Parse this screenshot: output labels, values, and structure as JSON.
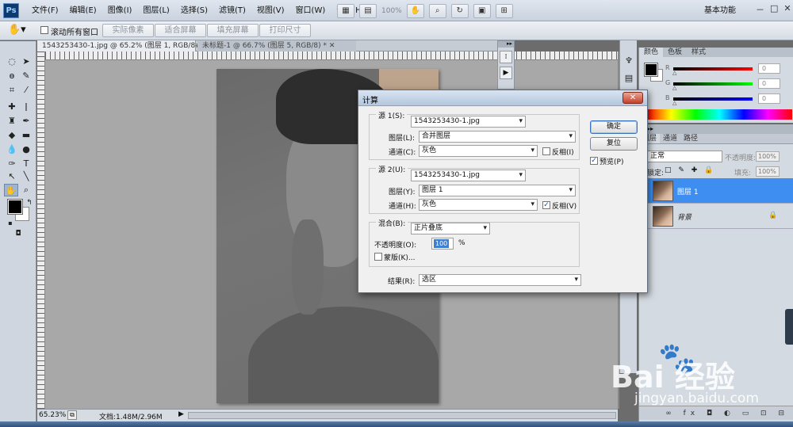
{
  "app": {
    "logo": "Ps"
  },
  "menu": [
    "文件(F)",
    "编辑(E)",
    "图像(I)",
    "图层(L)",
    "选择(S)",
    "滤镜(T)",
    "视图(V)",
    "窗口(W)",
    "帮助(H)"
  ],
  "menu_tools": {
    "zoom_value": "100%",
    "workspace": "基本功能"
  },
  "window_controls": [
    "－",
    "□",
    "✕"
  ],
  "options_bar": {
    "scroll_all_label": "滚动所有窗口",
    "buttons": [
      "实际像素",
      "适合屏幕",
      "填充屏幕",
      "打印尺寸"
    ]
  },
  "tabs": [
    {
      "label": "1543253430-1.jpg @ 65.2% (图层 1, RGB/8#) *  ✕"
    },
    {
      "label": "未标题-1 @ 66.7% (图层 5, RGB/8) *  ✕"
    }
  ],
  "status": {
    "zoom": "65.23%",
    "doc": "文档:1.48M/2.96M",
    "arrow": "▶"
  },
  "color_panel": {
    "tabs": [
      "颜色",
      "色板",
      "样式"
    ],
    "channels": [
      {
        "letter": "R",
        "value": "0",
        "color": "#ff0000"
      },
      {
        "letter": "G",
        "value": "0",
        "color": "#00ff00"
      },
      {
        "letter": "B",
        "value": "0",
        "color": "#0000ff"
      }
    ]
  },
  "layers_panel": {
    "tabs": [
      "图层",
      "通道",
      "路径"
    ],
    "blend_mode": "正常",
    "opacity_label": "不透明度:",
    "opacity": "100%",
    "lock_label": "锁定:",
    "fill_label": "填充:",
    "fill": "100%",
    "layers": [
      {
        "name": "图层 1",
        "selected": true
      },
      {
        "name": "背景",
        "selected": false,
        "locked": true
      }
    ],
    "footer_icons": "∞ fx ◘ ◐ ▭ ⊡ ⊟"
  },
  "dialog": {
    "title": "计算",
    "source1": {
      "label": "源 1(S):",
      "file": "1543253430-1.jpg",
      "layer_label": "图层(L):",
      "layer": "合并图层",
      "channel_label": "通道(C):",
      "channel": "灰色",
      "invert_label": "反相(I)",
      "invert": false
    },
    "source2": {
      "label": "源 2(U):",
      "file": "1543253430-1.jpg",
      "layer_label": "图层(Y):",
      "layer": "图层 1",
      "channel_label": "通道(H):",
      "channel": "灰色",
      "invert_label": "反相(V)",
      "invert": true
    },
    "blend": {
      "label": "混合(B):",
      "mode": "正片叠底",
      "opacity_label": "不透明度(O):",
      "opacity": "100",
      "percent": "%",
      "mask_label": "蒙版(K)..."
    },
    "result_label": "结果(R):",
    "result": "选区",
    "ok_label": "确定",
    "reset_label": "复位",
    "preview_label": "预览(P)",
    "preview": true
  },
  "watermark": {
    "text": "Bai  经验",
    "paw": "🐾",
    "url": "jingyan.baidu.com"
  }
}
